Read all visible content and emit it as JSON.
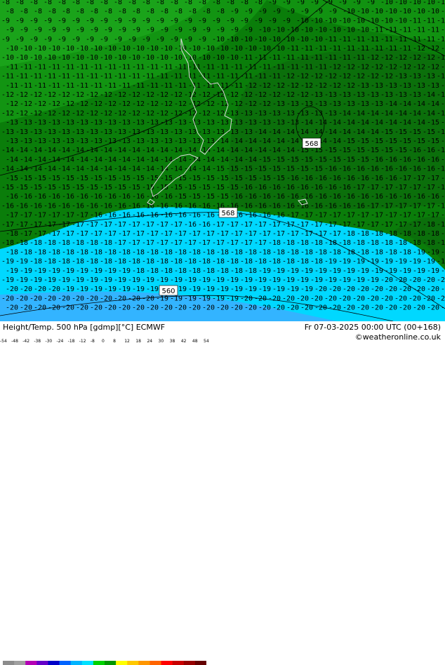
{
  "map": {
    "contour_labels": [
      "568",
      "568",
      "560"
    ],
    "temperature_values_visible": [
      "-8",
      "-9",
      "-10",
      "-11",
      "-12",
      "-13",
      "-14",
      "-15",
      "-16",
      "-17",
      "-18",
      "-19",
      "-20"
    ]
  },
  "footer": {
    "title": "Height/Temp. 500 hPa [gdmp][°C] ECMWF",
    "valid_time": "Fr 07-03-2025 00:00 UTC (00+168)",
    "credit": "©weatheronline.co.uk"
  },
  "colorbar": {
    "ticks": [
      "-54",
      "-48",
      "-42",
      "-38",
      "-30",
      "-24",
      "-18",
      "-12",
      "-8",
      "0",
      "8",
      "12",
      "18",
      "24",
      "30",
      "38",
      "42",
      "48",
      "54"
    ],
    "colors": [
      "#8c8c8c",
      "#a0a0a0",
      "#b400b4",
      "#6400c8",
      "#0000c8",
      "#0064ff",
      "#00b4ff",
      "#00e1ff",
      "#00d200",
      "#009600",
      "#ffff00",
      "#ffc800",
      "#ff9600",
      "#ff6400",
      "#ff0000",
      "#c80000",
      "#960000",
      "#640000"
    ]
  },
  "palette": {
    "green_dark": "#0a7d0a",
    "green_mid": "#108f10",
    "green_light": "#1aa31a",
    "cyan": "#00d8ff",
    "cyan_deep": "#33b4ff"
  }
}
